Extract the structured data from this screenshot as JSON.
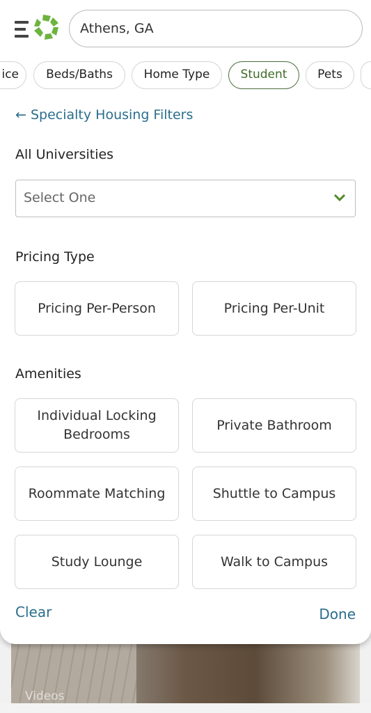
{
  "header": {
    "search_value": "Athens, GA",
    "logo_color": "#6db33f"
  },
  "filters": [
    {
      "label": "ice"
    },
    {
      "label": "Beds/Baths"
    },
    {
      "label": "Home Type"
    },
    {
      "label": "Student",
      "active": true
    },
    {
      "label": "Pets"
    },
    {
      "label": ""
    }
  ],
  "panel": {
    "back_label": "Specialty Housing Filters",
    "universities": {
      "heading": "All Universities",
      "value": "Select One"
    },
    "pricing": {
      "heading": "Pricing Type",
      "options": [
        "Pricing Per-Person",
        "Pricing Per-Unit"
      ]
    },
    "amenities": {
      "heading": "Amenities",
      "options": [
        "Individual Locking Bedrooms",
        "Private Bathroom",
        "Roommate Matching",
        "Shuttle to Campus",
        "Study Lounge",
        "Walk to Campus"
      ]
    },
    "clear_label": "Clear",
    "done_label": "Done"
  },
  "background": {
    "videos_label": "Videos"
  },
  "colors": {
    "link": "#2a6e8c",
    "active_chip": "#3f6b2a",
    "check": "#4e8a2a"
  }
}
